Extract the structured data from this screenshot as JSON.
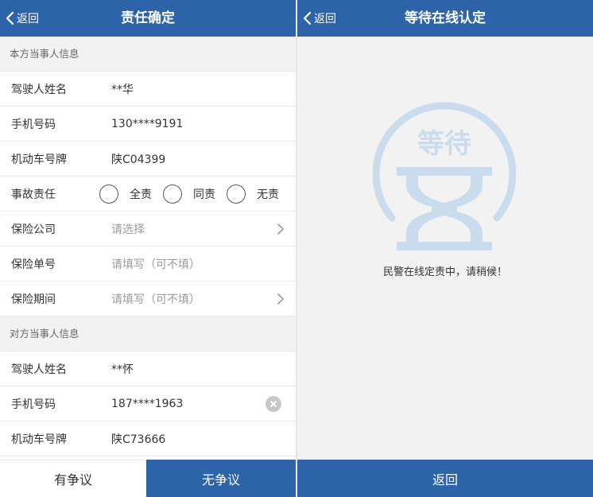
{
  "left": {
    "header": {
      "back_label": "返回",
      "title": "责任确定"
    },
    "own_section": {
      "title": "本方当事人信息"
    },
    "own_fields": [
      {
        "label": "驾驶人姓名",
        "value": "**华"
      },
      {
        "label": "手机号码",
        "value": "130****9191"
      },
      {
        "label": "机动车号牌",
        "value": "陕C04399"
      }
    ],
    "liability": {
      "label": "事故责任",
      "options": [
        "全责",
        "同责",
        "无责"
      ]
    },
    "insurance": {
      "company_label": "保险公司",
      "company_placeholder": "请选择",
      "policy_label": "保险单号",
      "policy_placeholder": "请填写（可不填）",
      "period_label": "保险期间",
      "period_placeholder": "请填写（可不填）"
    },
    "other_section": {
      "title": "对方当事人信息"
    },
    "other_fields": [
      {
        "label": "驾驶人姓名",
        "value": "**怀"
      },
      {
        "label": "手机号码",
        "value": "187****1963"
      },
      {
        "label": "机动车号牌",
        "value": "陕C73666"
      }
    ],
    "footer": {
      "dispute_label": "有争议",
      "no_dispute_label": "无争议"
    }
  },
  "right": {
    "header": {
      "back_label": "返回",
      "title": "等待在线认定"
    },
    "graphic_text": "等待",
    "message": "民警在线定责中，请稍候！",
    "return_label": "返回"
  },
  "colors": {
    "primary": "#2d63a8",
    "graphic": "#c9dced",
    "section_bg": "#f2f2f2"
  },
  "icons": [
    "chevron-left-icon",
    "chevron-right-icon",
    "clear-icon",
    "hourglass-icon"
  ]
}
